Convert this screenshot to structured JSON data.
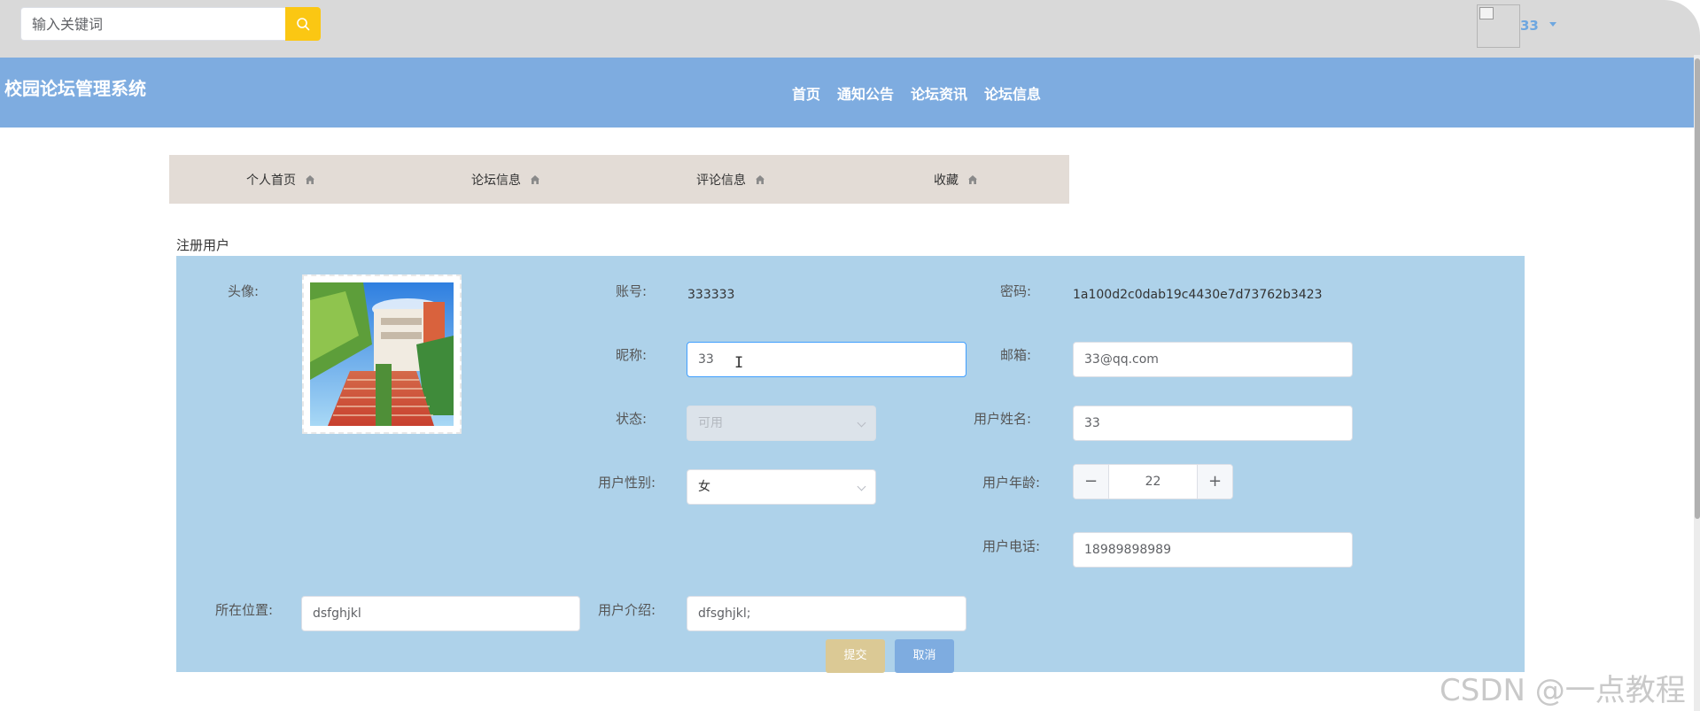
{
  "topbar": {
    "search_placeholder": "输入关键词",
    "search_icon": "search-icon",
    "accent_color": "#fbc713",
    "user_name": "33"
  },
  "header": {
    "title": "校园论坛管理系统",
    "nav": [
      "首页",
      "通知公告",
      "论坛资讯",
      "论坛信息"
    ],
    "color": "#7eace0"
  },
  "subtabs": [
    "个人首页",
    "论坛信息",
    "评论信息",
    "收藏"
  ],
  "form": {
    "section_title": "注册用户",
    "avatar_label": "头像:",
    "account_label": "账号:",
    "account_value": "333333",
    "password_label": "密码:",
    "password_value": "1a100d2c0dab19c4430e7d73762b3423",
    "nickname_label": "昵称:",
    "nickname_value": "33",
    "email_label": "邮箱:",
    "email_value": "33@qq.com",
    "status_label": "状态:",
    "status_value": "可用",
    "real_name_label": "用户姓名:",
    "real_name_value": "33",
    "gender_label": "用户性别:",
    "gender_value": "女",
    "age_label": "用户年龄:",
    "age_value": "22",
    "age_minus": "−",
    "age_plus": "+",
    "phone_label": "用户电话:",
    "phone_value": "18989898989",
    "location_label": "所在位置:",
    "location_value": "dsfghjkl",
    "intro_label": "用户介绍:",
    "intro_value": "dfsghjkl;",
    "submit_label": "提交",
    "cancel_label": "取消",
    "panel_color": "#aed2ea"
  },
  "watermark": "CSDN @一点教程"
}
